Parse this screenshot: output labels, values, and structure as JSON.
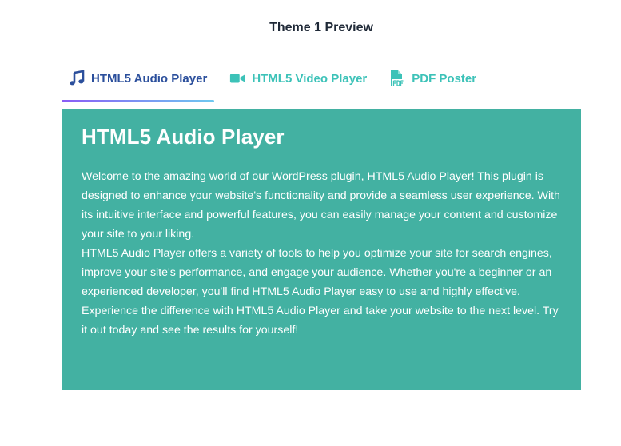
{
  "page": {
    "title": "Theme 1 Preview"
  },
  "tabs": [
    {
      "label": "HTML5 Audio Player",
      "icon": "music-note-icon",
      "active": true
    },
    {
      "label": "HTML5 Video Player",
      "icon": "video-camera-icon",
      "active": false
    },
    {
      "label": "PDF Poster",
      "icon": "pdf-file-icon",
      "active": false
    }
  ],
  "panel": {
    "heading": "HTML5 Audio Player",
    "paragraphs": [
      "Welcome to the amazing world of our WordPress plugin, HTML5 Audio Player! This plugin is designed to enhance your website's functionality and provide a seamless user experience. With its intuitive interface and powerful features, you can easily manage your content and customize your site to your liking.",
      "HTML5 Audio Player offers a variety of tools to help you optimize your site for search engines, improve your site's performance, and engage your audience. Whether you're a beginner or an experienced developer, you'll find HTML5 Audio Player easy to use and highly effective.",
      "Experience the difference with HTML5 Audio Player and take your website to the next level. Try it out today and see the results for yourself!"
    ]
  },
  "colors": {
    "active_tab": "#2b4f9c",
    "inactive_tab": "#3cc2b8",
    "panel_background": "#43b1a2",
    "underline_start": "#8a5cf6",
    "underline_end": "#6ec9f0"
  }
}
